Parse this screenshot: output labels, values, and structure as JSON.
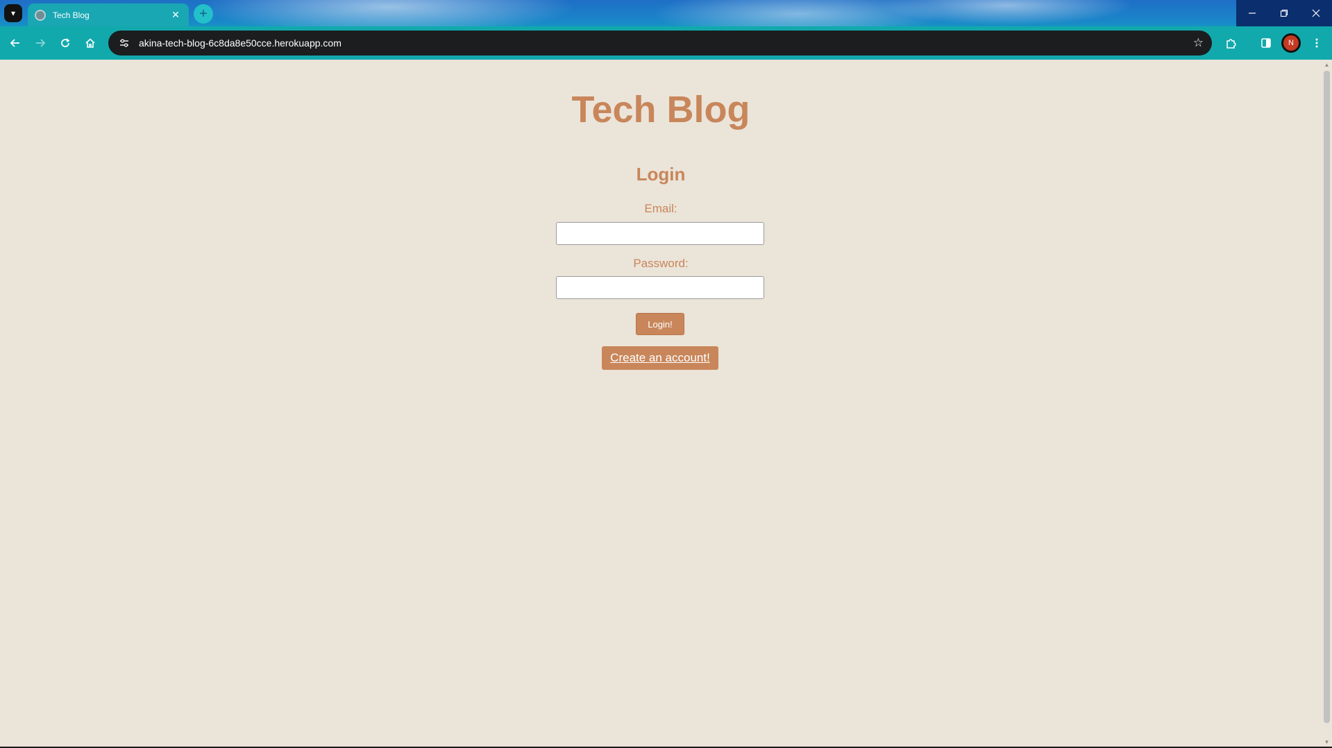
{
  "browser": {
    "tab_title": "Tech Blog",
    "tab_close_glyph": "✕",
    "new_tab_glyph": "+",
    "url": "akina-tech-blog-6c8da8e50cce.herokuapp.com",
    "profile_initial": "N",
    "icons": {
      "tab_search": "chevron-down-icon",
      "back": "back-arrow-icon",
      "forward": "forward-arrow-icon",
      "reload": "reload-icon",
      "home": "home-icon",
      "site_info": "tune-icon",
      "bookmark": "star-icon",
      "extensions": "puzzle-icon",
      "side_panel": "side-panel-icon",
      "menu": "kebab-menu-icon",
      "minimize": "minimize-icon",
      "restore": "restore-icon",
      "close": "close-icon"
    }
  },
  "page": {
    "site_title": "Tech Blog",
    "form_heading": "Login",
    "email_label": "Email:",
    "email_value": "",
    "password_label": "Password:",
    "password_value": "",
    "login_button": "Login!",
    "signup_link": "Create an account!"
  },
  "colors": {
    "page_background": "#ebe4d9",
    "accent": "#c8865a"
  }
}
